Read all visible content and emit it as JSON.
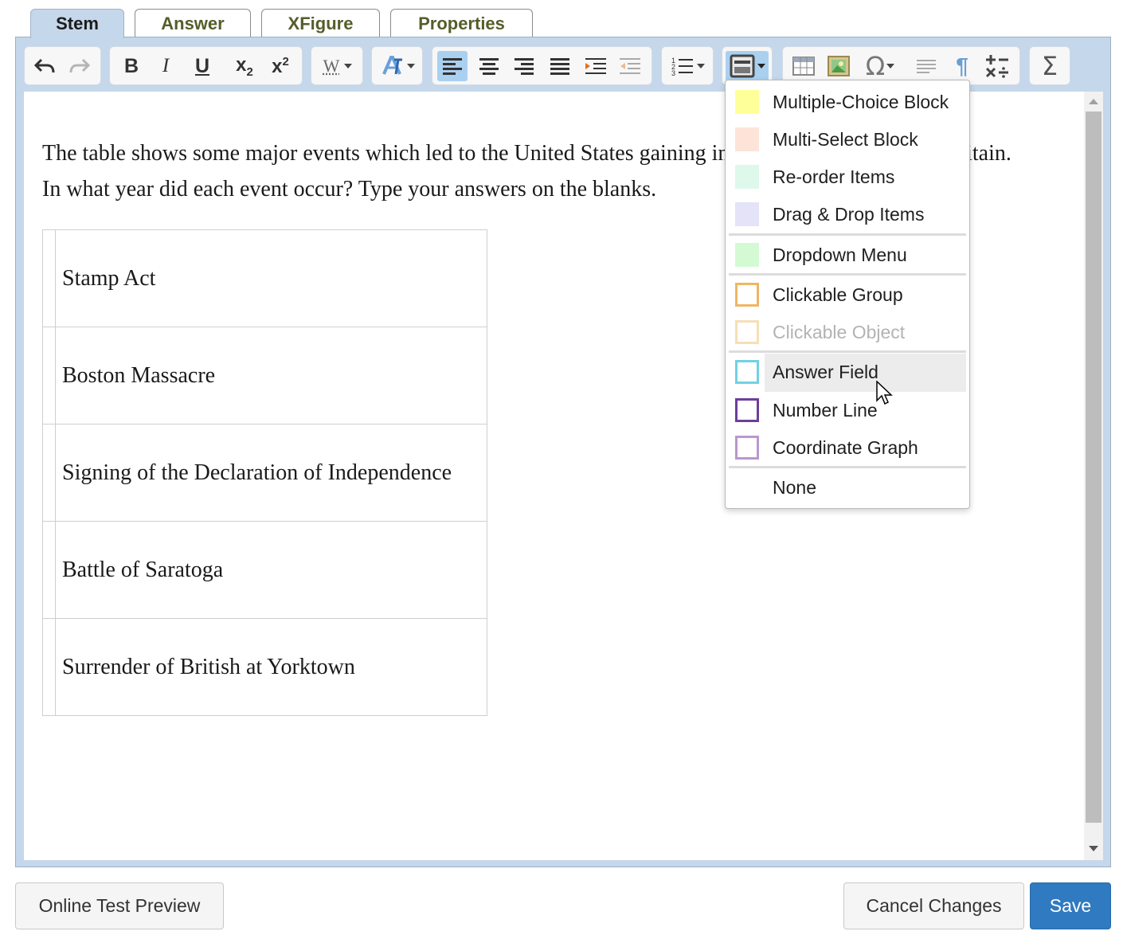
{
  "tabs": [
    {
      "label": "Stem",
      "active": true
    },
    {
      "label": "Answer"
    },
    {
      "label": "XFigure"
    },
    {
      "label": "Properties"
    }
  ],
  "toolbar": {
    "icons": [
      "undo-icon",
      "redo-icon",
      "bold-icon",
      "italic-icon",
      "underline-icon",
      "subscript-icon",
      "superscript-icon",
      "word-style-icon",
      "text-style-icon",
      "align-left-icon",
      "align-center-icon",
      "align-right-icon",
      "justify-icon",
      "indent-icon",
      "outdent-icon",
      "numbered-list-icon",
      "interaction-block-icon",
      "table-icon",
      "image-icon",
      "special-char-icon",
      "show-blocks-icon",
      "paragraph-icon",
      "math-operators-icon",
      "sigma-icon"
    ],
    "glyphs": {
      "italic": "I",
      "bold": "B",
      "underline": "U",
      "omega": "Ω",
      "sigma": "Σ",
      "pilcrow": "¶",
      "w": "W",
      "x": "x",
      "sub": "2",
      "sup": "2"
    }
  },
  "stem": {
    "text": "The table shows some major events which led to the United States gaining independence from Great Britain. In what year did each event occur? Type your answers on the blanks."
  },
  "events_table": {
    "rows": [
      "Stamp Act",
      "Boston Massacre",
      "Signing of the Declaration of Independence",
      "Battle of Saratoga",
      "Surrender of British at Yorktown"
    ]
  },
  "dropdown_menu": {
    "items": [
      {
        "label": "Multiple-Choice Block",
        "color": "#ffff99",
        "style": "fill"
      },
      {
        "label": "Multi-Select Block",
        "color": "#fde4d8",
        "style": "fill"
      },
      {
        "label": "Re-order Items",
        "color": "#def8ec",
        "style": "fill"
      },
      {
        "label": "Drag & Drop Items",
        "color": "#e4e3f7",
        "style": "fill"
      },
      {
        "label": "Dropdown Menu",
        "color": "#d4fad4",
        "style": "fill"
      },
      {
        "label": "Clickable Group",
        "color": "#efb662",
        "style": "outline"
      },
      {
        "label": "Clickable Object",
        "color": "#f6dfb5",
        "style": "outline",
        "disabled": true
      },
      {
        "label": "Answer Field",
        "color": "#70d2e2",
        "style": "outline",
        "highlighted": true
      },
      {
        "label": "Number Line",
        "color": "#6d3e9c",
        "style": "outline"
      },
      {
        "label": "Coordinate Graph",
        "color": "#b998cf",
        "style": "outline"
      },
      {
        "label": "None",
        "color": "",
        "style": "none"
      }
    ]
  },
  "footer": {
    "preview_label": "Online Test Preview",
    "cancel_label": "Cancel Changes",
    "save_label": "Save"
  },
  "colors": {
    "accent": "#2f7ac0",
    "toolbar_bg": "#c5d7ea",
    "tab_text": "#565d2a",
    "active_button": "#aad0f0"
  }
}
